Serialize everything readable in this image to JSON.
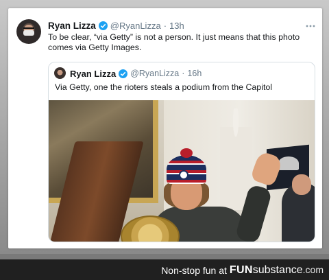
{
  "tweet": {
    "author_name": "Ryan Lizza",
    "author_handle": "@RyanLizza",
    "separator": "·",
    "time": "13h",
    "text": "To be clear, “via Getty” is not a person. It just means that this photo comes via Getty Images.",
    "more_icon": "more-horizontal-icon"
  },
  "quoted_tweet": {
    "author_name": "Ryan Lizza",
    "author_handle": "@RyanLizza",
    "separator": "·",
    "time": "16h",
    "text": "Via Getty, one the rioters steals a podium from the Capitol"
  },
  "colors": {
    "verified": "#1da1f2",
    "footer_bg": "#202020",
    "text": "#14171a",
    "muted": "#657786"
  },
  "footer": {
    "tagline": "Non-stop fun at",
    "brand_fun": "FUN",
    "brand_sub": "substance",
    "brand_tld": ".com"
  }
}
